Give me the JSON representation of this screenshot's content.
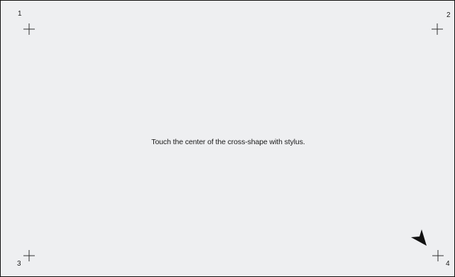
{
  "calibration": {
    "instruction": "Touch the center of the cross-shape with stylus.",
    "targets": [
      {
        "id": "target-1",
        "number": "1",
        "icon": "crosshair-icon"
      },
      {
        "id": "target-2",
        "number": "2",
        "icon": "crosshair-icon"
      },
      {
        "id": "target-3",
        "number": "3",
        "icon": "crosshair-icon"
      },
      {
        "id": "target-4",
        "number": "4",
        "icon": "crosshair-icon"
      }
    ],
    "pointer_icon": "arrow-pointer-icon",
    "colors": {
      "background": "#eeeff1",
      "border": "#111111",
      "text": "#1a1a1a",
      "cross": "#333333"
    }
  }
}
